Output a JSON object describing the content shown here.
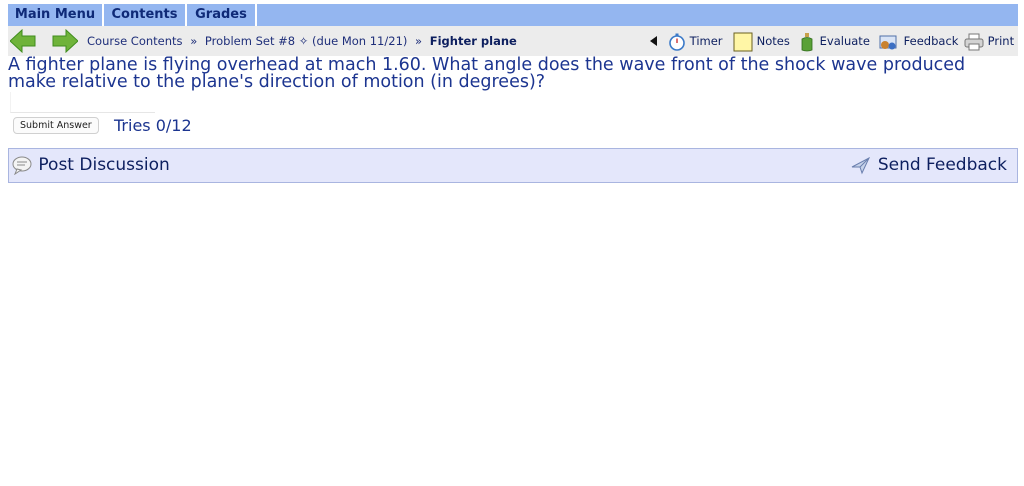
{
  "menu": {
    "tabs": [
      "Main Menu",
      "Contents",
      "Grades"
    ]
  },
  "breadcrumbs": {
    "items": [
      "Course Contents",
      "Problem Set #8",
      "(due Mon 11/21)",
      "Fighter plane"
    ],
    "separator": "»",
    "set_marker": "✧"
  },
  "tools": {
    "timer": "Timer",
    "notes": "Notes",
    "evaluate": "Evaluate",
    "feedback": "Feedback",
    "print": "Print"
  },
  "problem": {
    "text": "A fighter plane is flying overhead at mach 1.60. What angle does the wave front of the shock wave produced make relative to the plane's direction of motion (in degrees)?",
    "answer_value": "",
    "submit_label": "Submit Answer",
    "tries": "Tries 0/12"
  },
  "discussion": {
    "post_label": "Post Discussion",
    "send_label": "Send Feedback"
  },
  "colors": {
    "menu_bar": "#94b6f0",
    "nav_bar": "#ececec",
    "text_blue": "#1c3590",
    "discussion_bg": "#e4e7fb",
    "arrow_green": "#6fb33a"
  }
}
